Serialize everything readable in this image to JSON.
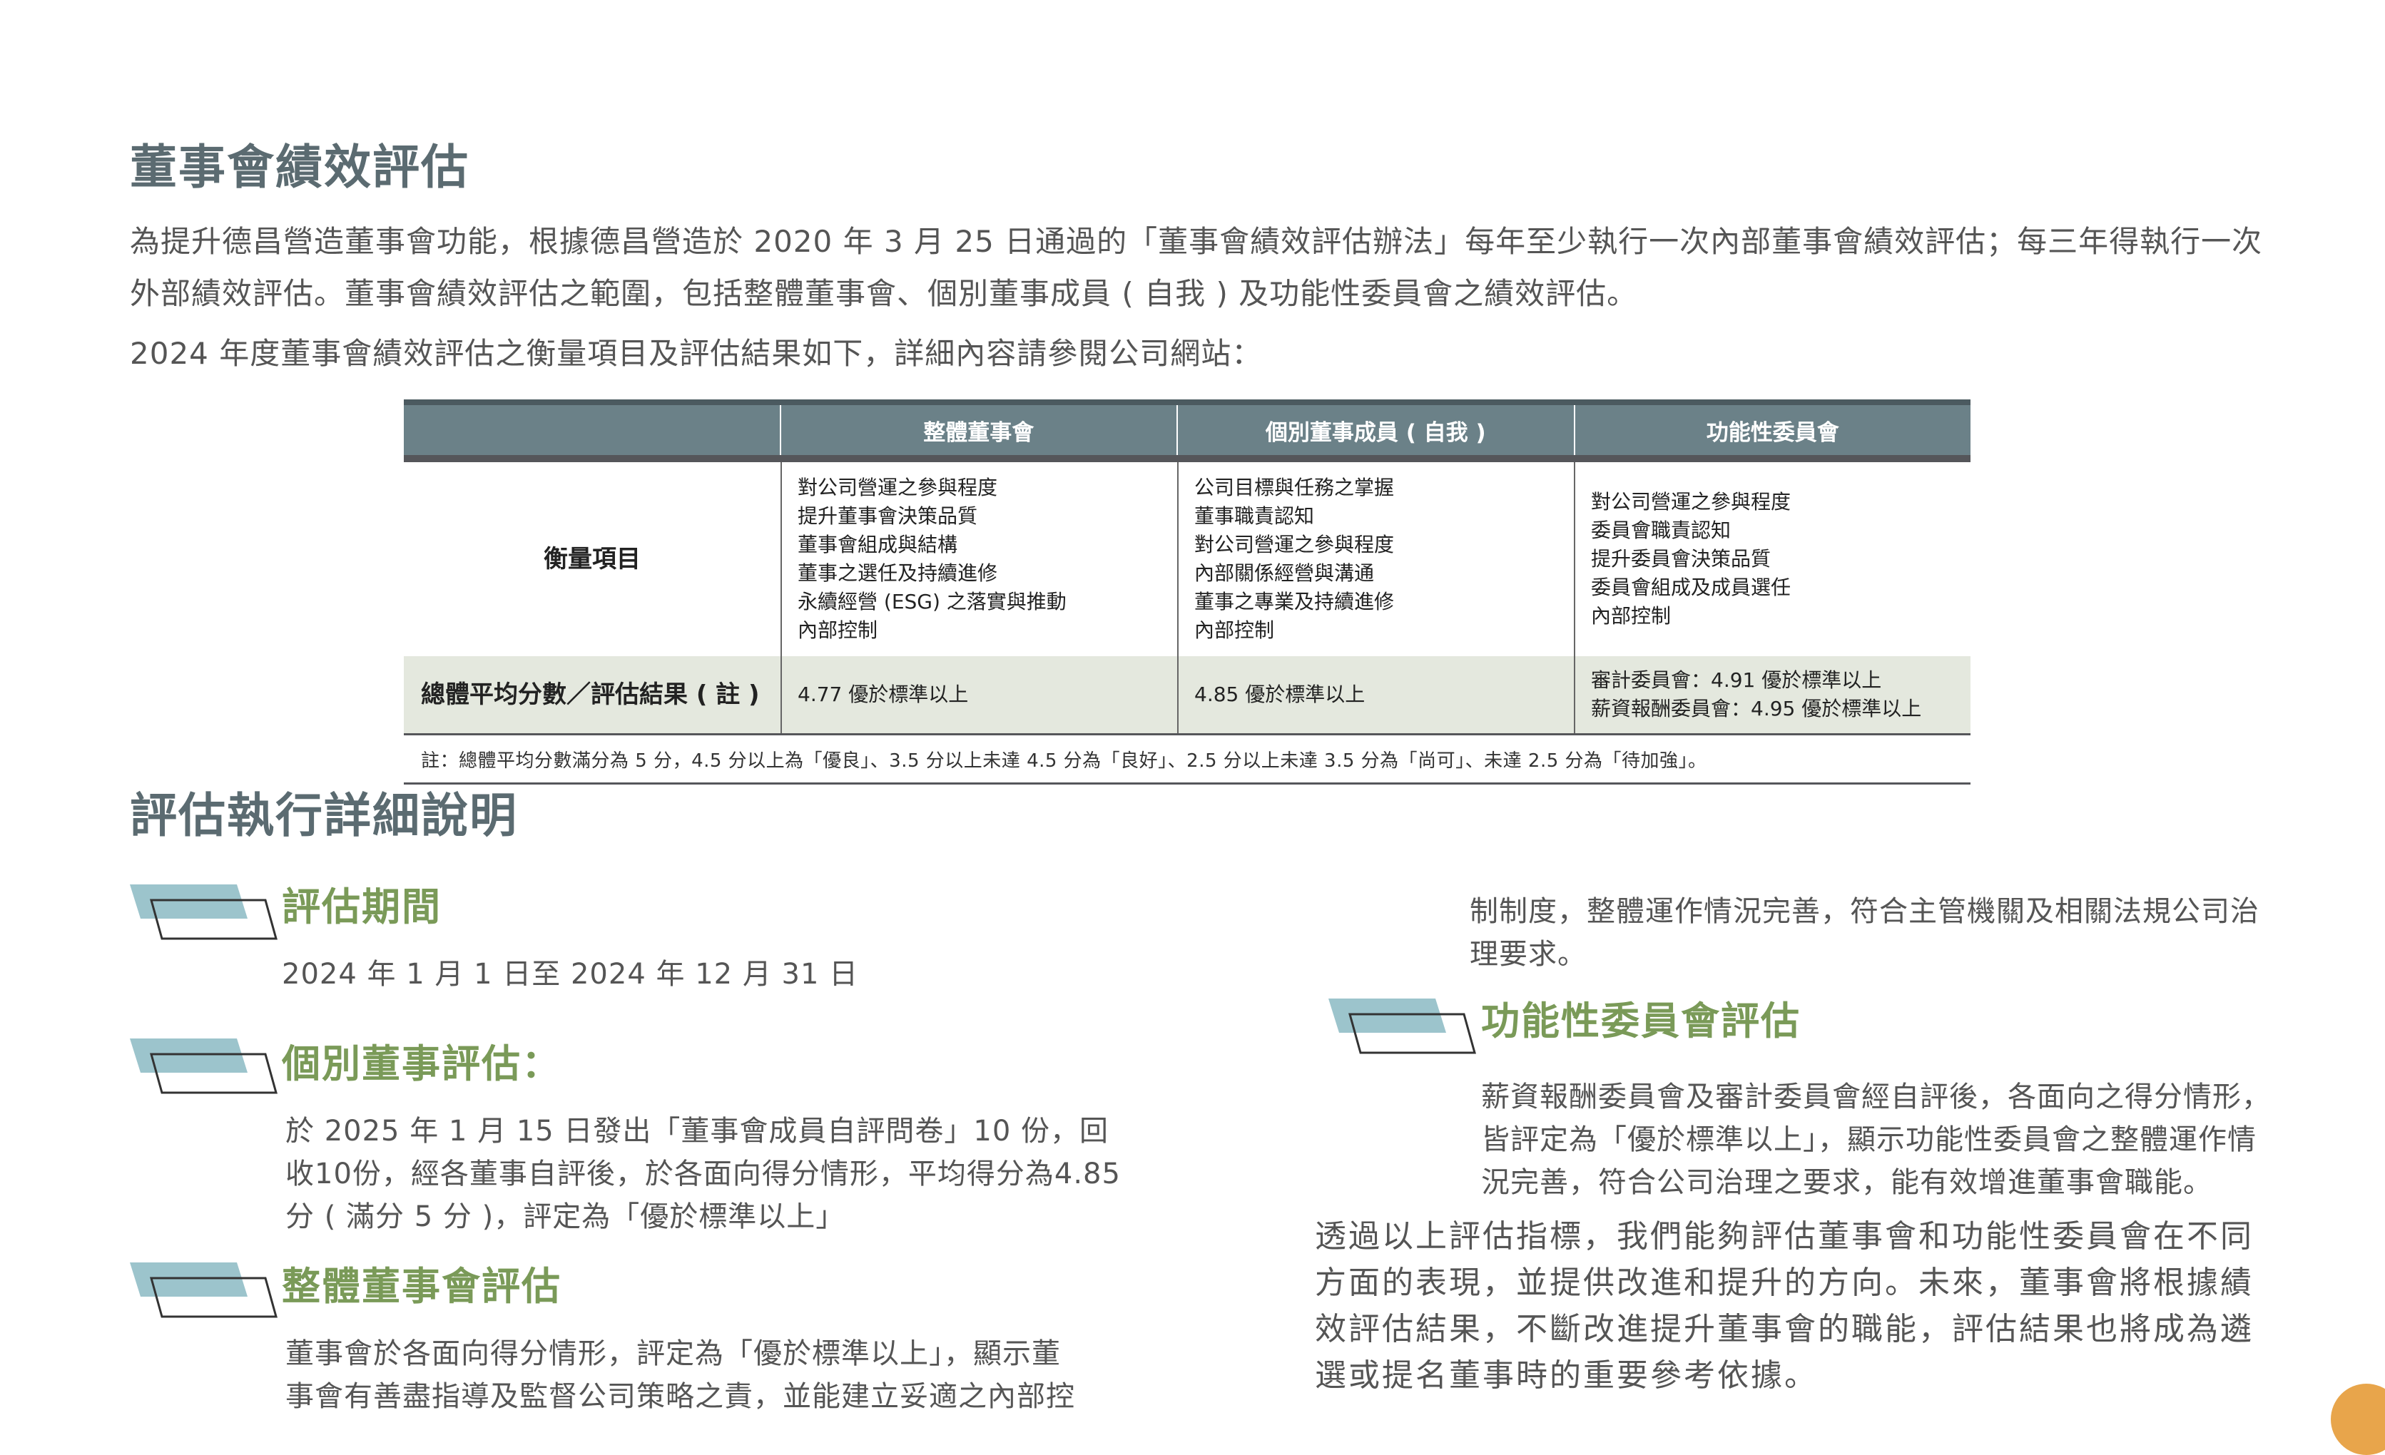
{
  "title": "董事會績效評估",
  "intro": {
    "paragraph1": "為提升德昌營造董事會功能，根據德昌營造於 2020 年 3 月 25 日通過的「董事會績效評估辦法」每年至少執行一次內部董事會績效評估；每三年得執行一次外部績效評估。董事會績效評估之範圍，包括整體董事會、個別董事成員 ( 自我 ) 及功能性委員會之績效評估。",
    "paragraph2": "2024 年度董事會績效評估之衡量項目及評估結果如下，詳細內容請參閱公司網站："
  },
  "table": {
    "headers": [
      "",
      "整體董事會",
      "個別董事成員 ( 自我 )",
      "功能性委員會"
    ],
    "row1_label": "衡量項目",
    "col1_items": [
      "對公司營運之參與程度",
      "提升董事會決策品質",
      "董事會組成與結構",
      "董事之選任及持續進修",
      "永續經營 (ESG) 之落實與推動",
      "內部控制"
    ],
    "col2_items": [
      "公司目標與任務之掌握",
      "董事職責認知",
      "對公司營運之參與程度",
      "內部關係經營與溝通",
      "董事之專業及持續進修",
      "內部控制"
    ],
    "col3_items": [
      "對公司營運之參與程度",
      "委員會職責認知",
      "提升委員會決策品質",
      "委員會組成及成員選任",
      "內部控制"
    ],
    "row2_label": "總體平均分數／評估結果 ( 註 )",
    "row2_col1": "4.77 優於標準以上",
    "row2_col2": "4.85 優於標準以上",
    "row2_col3": [
      "審計委員會：4.91 優於標準以上",
      "薪資報酬委員會：4.95 優於標準以上"
    ],
    "note": "註：總體平均分數滿分為 5 分，4.5 分以上為「優良」、3.5 分以上未達 4.5 分為「良好」、2.5 分以上未達 3.5 分為「尚可」、未達 2.5 分為「待加強」。"
  },
  "section_title": "評估執行詳細說明",
  "sections": {
    "period": {
      "title": "評估期間",
      "text": "2024 年 1 月 1 日至 2024 年 12 月 31 日"
    },
    "individual": {
      "title": "個別董事評估：",
      "lines": [
        "於 2025 年 1 月 15 日發出「董事會成員自評問卷」10 份，回",
        "收10份，經各董事自評後，於各面向得分情形，平均得分為4.85",
        "分 ( 滿分 5 分 )，評定為「優於標準以上」"
      ]
    },
    "board": {
      "title": "整體董事會評估",
      "lines": [
        "董事會於各面向得分情形，評定為「優於標準以上」，顯示董",
        "事會有善盡指導及監督公司策略之責，並能建立妥適之內部控"
      ]
    },
    "board_continued": [
      "制制度，整體運作情況完善，符合主管機關及相關法規公司治",
      "理要求。"
    ],
    "committee": {
      "title": "功能性委員會評估",
      "lines": [
        "薪資報酬委員會及審計委員會經自評後，各面向之得分情形，",
        "皆評定為「優於標準以上」，顯示功能性委員會之整體運作情",
        "況完善，符合公司治理之要求，能有效增進董事會職能。"
      ]
    }
  },
  "closing": [
    "透過以上評估指標，我們能夠評估董事會和功能性委員會在不同",
    "方面的表現，並提供改進和提升的方向。未來，董事會將根據績",
    "效評估結果，不斷改進提升董事會的職能，評估結果也將成為遴",
    "選或提名董事時的重要參考依據。"
  ],
  "colors": {
    "title": "#5b6b71",
    "subtitle": "#7a9a58",
    "table_header": "#6b8188",
    "table_result_row": "#e4e8de",
    "badge_fill": "#9cc4cc",
    "page_dot": "#e8a54b"
  }
}
